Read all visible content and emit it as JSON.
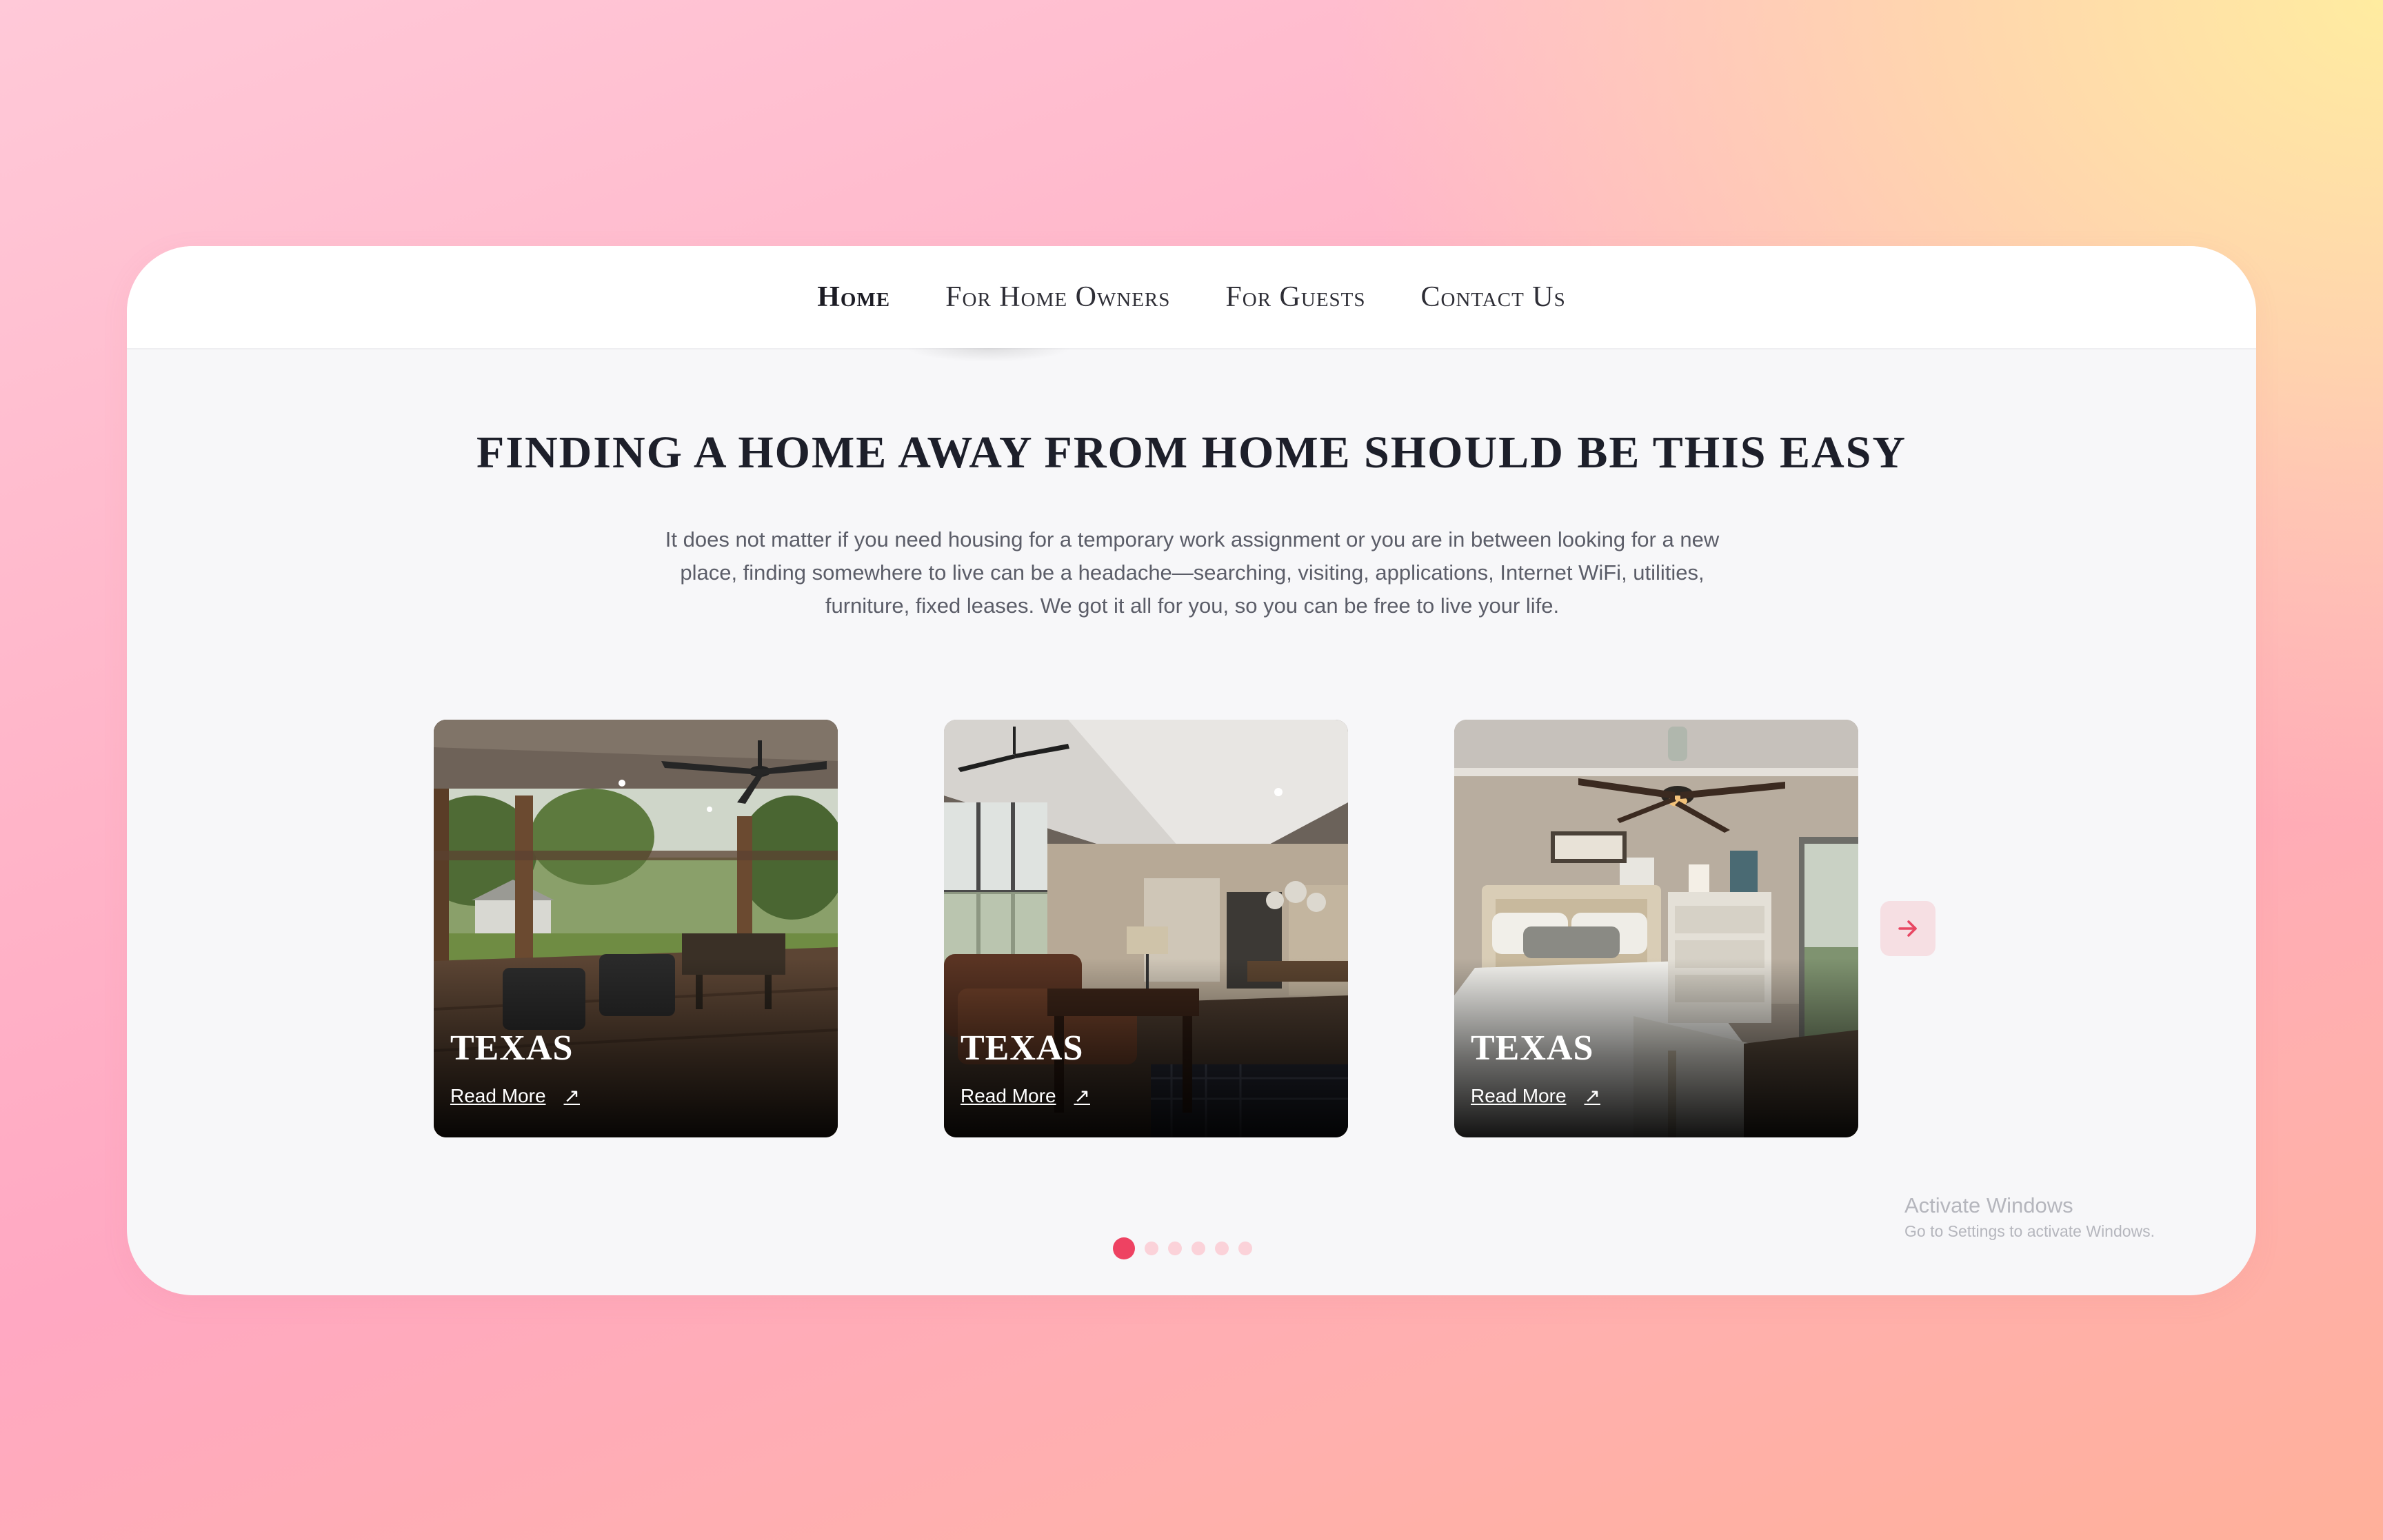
{
  "nav": {
    "items": [
      {
        "label": "Home",
        "active": true
      },
      {
        "label": "For Home Owners",
        "active": false
      },
      {
        "label": "For Guests",
        "active": false
      },
      {
        "label": "Contact Us",
        "active": false
      }
    ]
  },
  "hero": {
    "title": "FINDING A HOME AWAY FROM HOME SHOULD BE THIS EASY",
    "description": "It does not matter if you need housing for a temporary work assignment or you are in between looking for a new place, finding somewhere to live can be a headache—searching, visiting, applications, Internet WiFi, utilities, furniture, fixed leases. We got it all for you, so you can be free to live your life."
  },
  "carousel": {
    "cards": [
      {
        "title": "TEXAS",
        "link_label": "Read More",
        "image": "covered porch with ceiling fan"
      },
      {
        "title": "TEXAS",
        "link_label": "Read More",
        "image": "living room with leather sofa"
      },
      {
        "title": "TEXAS",
        "link_label": "Read More",
        "image": "bedroom with ceiling fan"
      }
    ],
    "next_icon": "arrow-right-icon",
    "dots_total": 6,
    "active_dot": 1
  },
  "watermark": {
    "title": "Activate Windows",
    "subtitle": "Go to Settings to activate Windows."
  },
  "colors": {
    "accent": "#ee4262",
    "dot_inactive": "#fbd2d9",
    "heading": "#1d1f2a",
    "body_text": "#5b5d68"
  }
}
